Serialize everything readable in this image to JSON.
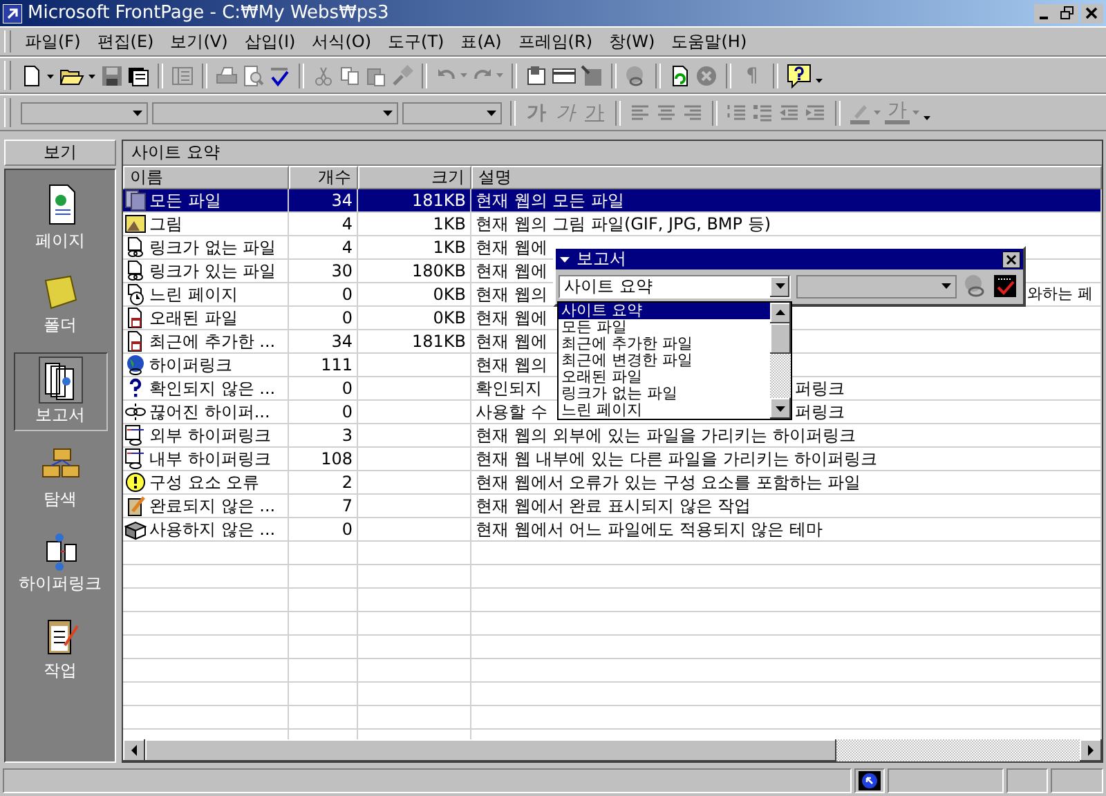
{
  "window": {
    "title": "Microsoft FrontPage - C:₩My Webs₩ps3"
  },
  "menu": [
    "파일(F)",
    "편집(E)",
    "보기(V)",
    "삽입(I)",
    "서식(O)",
    "도구(T)",
    "표(A)",
    "프레임(R)",
    "창(W)",
    "도움말(H)"
  ],
  "toolbar": {
    "paragraph": "¶"
  },
  "format_toolbar": {
    "bold": "가",
    "italic": "가",
    "underline": "가",
    "font_color": "가"
  },
  "views": {
    "title": "보기",
    "items": [
      {
        "label": "페이지",
        "selected": false
      },
      {
        "label": "폴더",
        "selected": false
      },
      {
        "label": "보고서",
        "selected": true
      },
      {
        "label": "탐색",
        "selected": false
      },
      {
        "label": "하이퍼링크",
        "selected": false
      },
      {
        "label": "작업",
        "selected": false
      }
    ]
  },
  "report": {
    "title": "사이트 요약",
    "columns": [
      "이름",
      "개수",
      "크기",
      "설명"
    ],
    "rows": [
      {
        "name": "모든 파일",
        "count": "34",
        "size": "181KB",
        "description": "현재 웹의 모든 파일",
        "selected": true
      },
      {
        "name": "그림",
        "count": "4",
        "size": "1KB",
        "description": "현재 웹의 그림 파일(GIF, JPG, BMP 등)",
        "selected": false
      },
      {
        "name": "링크가 없는 파일",
        "count": "4",
        "size": "1KB",
        "description": "현재 웹에",
        "selected": false
      },
      {
        "name": "링크가 있는 파일",
        "count": "30",
        "size": "180KB",
        "description": "현재 웹에",
        "selected": false
      },
      {
        "name": "느린 페이지",
        "count": "0",
        "size": "0KB",
        "description": "현재 웹의",
        "tail": "와하는 페",
        "selected": false
      },
      {
        "name": "오래된 파일",
        "count": "0",
        "size": "0KB",
        "description": "현재 웹에",
        "selected": false
      },
      {
        "name": "최근에 추가한 ...",
        "count": "34",
        "size": "181KB",
        "description": "현재 웹에",
        "selected": false
      },
      {
        "name": "하이퍼링크",
        "count": "111",
        "description": "현재 웹의",
        "selected": false
      },
      {
        "name": "확인되지 않은 ...",
        "count": "0",
        "description": "확인되지",
        "tail": "퍼링크",
        "selected": false
      },
      {
        "name": "끊어진 하이퍼...",
        "count": "0",
        "description": "사용할 수",
        "tail": "퍼링크",
        "selected": false
      },
      {
        "name": "외부 하이퍼링크",
        "count": "3",
        "description": "현재 웹의 외부에 있는 파일을 가리키는 하이퍼링크",
        "selected": false
      },
      {
        "name": "내부 하이퍼링크",
        "count": "108",
        "description": "현재 웹 내부에 있는 다른 파일을 가리키는 하이퍼링크",
        "selected": false
      },
      {
        "name": "구성 요소 오류",
        "count": "2",
        "description": "현재 웹에서 오류가 있는 구성 요소를 포함하는 파일",
        "selected": false
      },
      {
        "name": "완료되지 않은 ...",
        "count": "7",
        "description": "현재 웹에서 완료 표시되지 않은 작업",
        "selected": false
      },
      {
        "name": "사용하지 않은 ...",
        "count": "0",
        "description": "현재 웹에서 어느 파일에도 적용되지 않은 테마",
        "selected": false
      }
    ]
  },
  "reports_toolbar": {
    "title": "보고서",
    "value": "사이트 요약",
    "options": [
      {
        "label": "사이트 요약",
        "selected": true
      },
      {
        "label": "모든 파일",
        "selected": false
      },
      {
        "label": "최근에 추가한 파일",
        "selected": false
      },
      {
        "label": "최근에 변경한 파일",
        "selected": false
      },
      {
        "label": "오래된 파일",
        "selected": false
      },
      {
        "label": "링크가 없는 파일",
        "selected": false
      },
      {
        "label": "느린 페이지",
        "selected": false
      }
    ]
  }
}
